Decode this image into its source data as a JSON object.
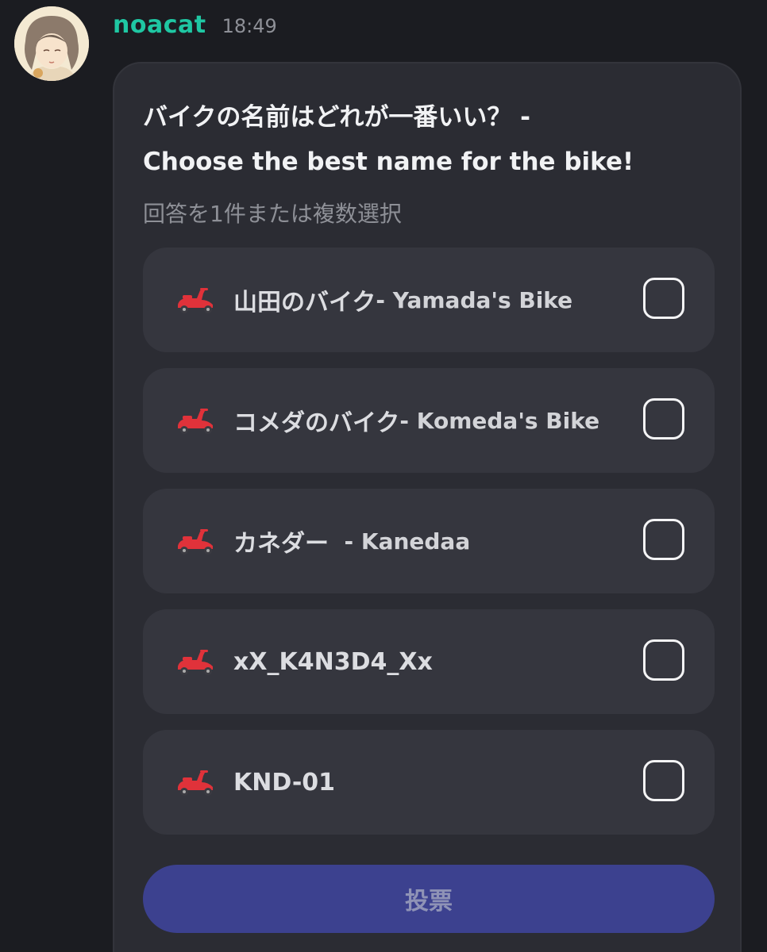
{
  "message": {
    "author": "noacat",
    "timestamp": "18:49"
  },
  "poll": {
    "title_line1": "バイクの名前はどれが一番いい？ -",
    "title_line2": "Choose the best name for the bike!",
    "subtitle": "回答を1件または複数選択",
    "options": [
      {
        "icon": "scooter-icon",
        "label": "山田のバイク",
        "label_en": " - Yamada's Bike"
      },
      {
        "icon": "scooter-icon",
        "label": "コメダのバイク",
        "label_en": " - Komeda's Bike"
      },
      {
        "icon": "scooter-icon",
        "label": "カネダー",
        "label_en": "  - Kanedaa"
      },
      {
        "icon": "scooter-icon",
        "label": "xX_K4N3D4_Xx",
        "label_en": ""
      },
      {
        "icon": "scooter-icon",
        "label": "KND-01",
        "label_en": ""
      }
    ],
    "vote_label": "投票"
  },
  "colors": {
    "background": "#1b1c21",
    "card": "#2b2c33",
    "option": "#35363e",
    "username": "#1fc7a3",
    "vote_button": "#3c418f",
    "scooter": "#e0323a"
  }
}
